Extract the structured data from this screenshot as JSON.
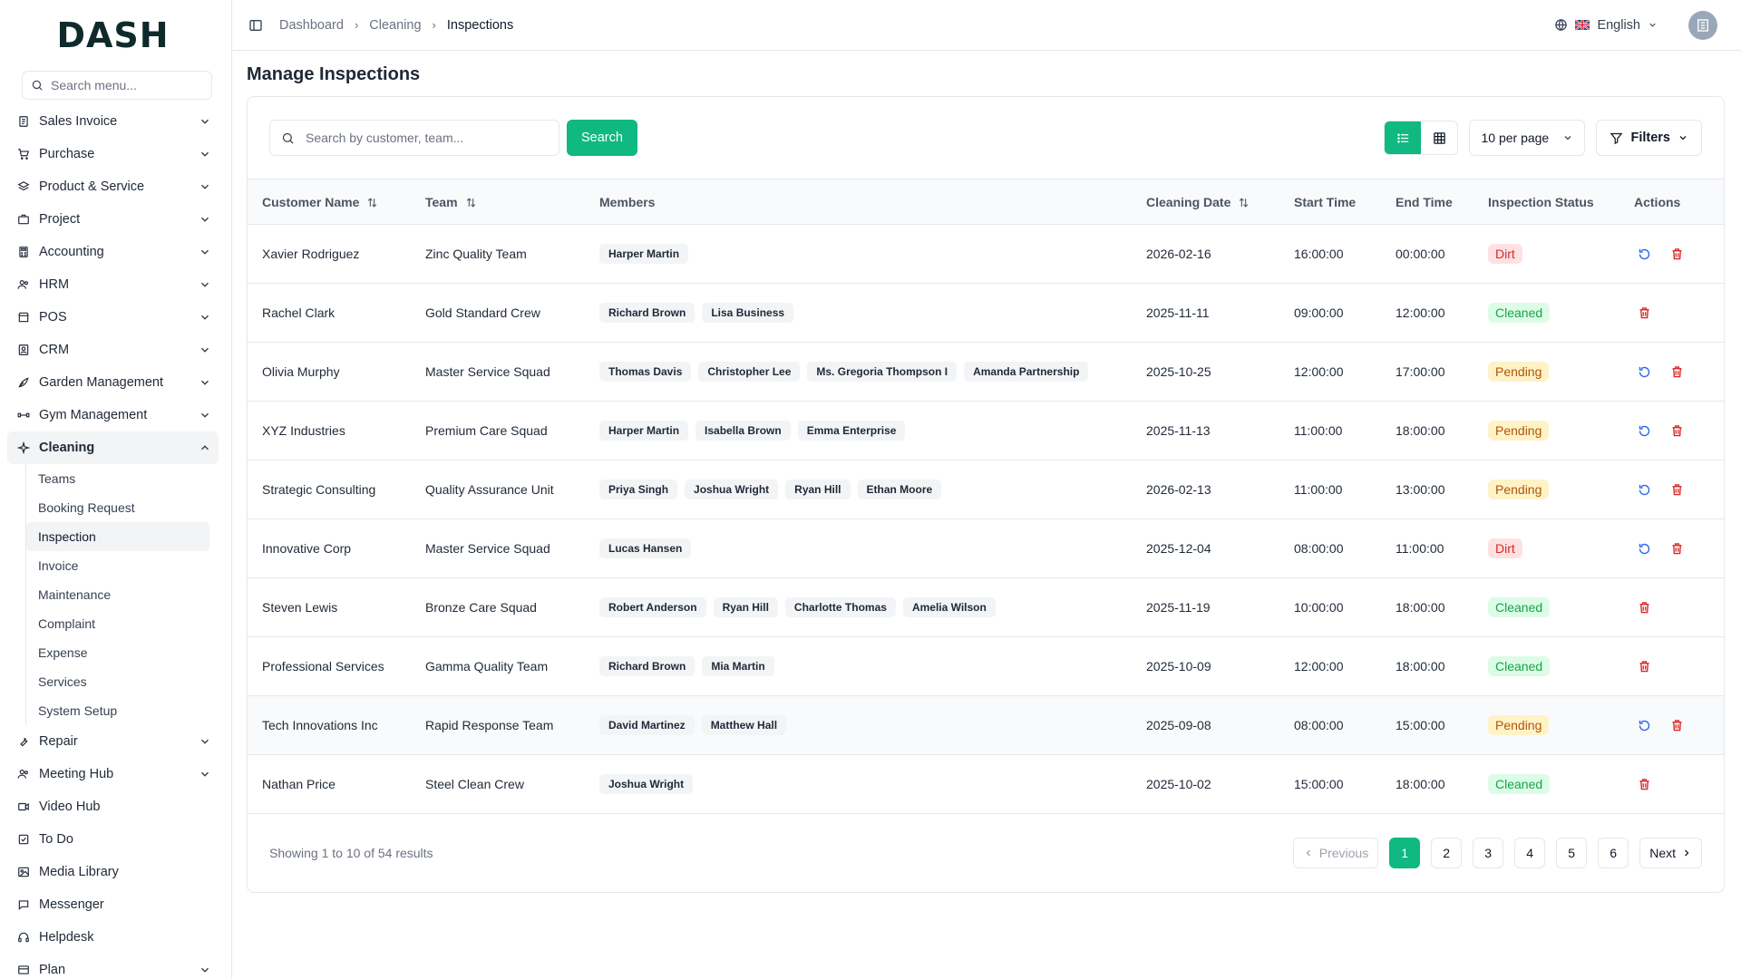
{
  "brand": {
    "logo": "DASH"
  },
  "sidebar": {
    "search_placeholder": "Search menu...",
    "items": [
      {
        "label": "Sales Invoice",
        "icon": "invoice-icon",
        "chevron": true
      },
      {
        "label": "Purchase",
        "icon": "cart-icon",
        "chevron": true
      },
      {
        "label": "Product & Service",
        "icon": "layers-icon",
        "chevron": true
      },
      {
        "label": "Project",
        "icon": "briefcase-icon",
        "chevron": true
      },
      {
        "label": "Accounting",
        "icon": "calculator-icon",
        "chevron": true
      },
      {
        "label": "HRM",
        "icon": "users-icon",
        "chevron": true
      },
      {
        "label": "POS",
        "icon": "store-icon",
        "chevron": true
      },
      {
        "label": "CRM",
        "icon": "contact-icon",
        "chevron": true
      },
      {
        "label": "Garden Management",
        "icon": "leaf-icon",
        "chevron": true
      },
      {
        "label": "Gym Management",
        "icon": "dumbbell-icon",
        "chevron": true
      },
      {
        "label": "Cleaning",
        "icon": "sparkle-icon",
        "chevron": true,
        "active": true
      }
    ],
    "cleaning_sub": [
      "Teams",
      "Booking Request",
      "Inspection",
      "Invoice",
      "Maintenance",
      "Complaint",
      "Expense",
      "Services",
      "System Setup"
    ],
    "items_after": [
      {
        "label": "Repair",
        "icon": "wrench-icon",
        "chevron": true
      },
      {
        "label": "Meeting Hub",
        "icon": "users-icon",
        "chevron": true
      },
      {
        "label": "Video Hub",
        "icon": "video-icon",
        "chevron": false
      },
      {
        "label": "To Do",
        "icon": "checkbox-icon",
        "chevron": false
      },
      {
        "label": "Media Library",
        "icon": "image-icon",
        "chevron": false
      },
      {
        "label": "Messenger",
        "icon": "message-icon",
        "chevron": false
      },
      {
        "label": "Helpdesk",
        "icon": "headset-icon",
        "chevron": false
      },
      {
        "label": "Plan",
        "icon": "card-icon",
        "chevron": true
      }
    ]
  },
  "topbar": {
    "breadcrumb": [
      "Dashboard",
      "Cleaning",
      "Inspections"
    ],
    "language": "English"
  },
  "page": {
    "title": "Manage Inspections"
  },
  "toolbar": {
    "search_placeholder": "Search by customer, team...",
    "search_button": "Search",
    "per_page": "10 per page",
    "filters": "Filters"
  },
  "table": {
    "headers": [
      "Customer Name",
      "Team",
      "Members",
      "Cleaning Date",
      "Start Time",
      "End Time",
      "Inspection Status",
      "Actions"
    ],
    "rows": [
      {
        "customer": "Xavier Rodriguez",
        "team": "Zinc Quality Team",
        "members": [
          "Harper Martin"
        ],
        "date": "2026-02-16",
        "start": "16:00:00",
        "end": "00:00:00",
        "status": "Dirt",
        "reset": true
      },
      {
        "customer": "Rachel Clark",
        "team": "Gold Standard Crew",
        "members": [
          "Richard Brown",
          "Lisa Business"
        ],
        "date": "2025-11-11",
        "start": "09:00:00",
        "end": "12:00:00",
        "status": "Cleaned",
        "reset": false
      },
      {
        "customer": "Olivia Murphy",
        "team": "Master Service Squad",
        "members": [
          "Thomas Davis",
          "Christopher Lee",
          "Ms. Gregoria Thompson I",
          "Amanda Partnership"
        ],
        "date": "2025-10-25",
        "start": "12:00:00",
        "end": "17:00:00",
        "status": "Pending",
        "reset": true
      },
      {
        "customer": "XYZ Industries",
        "team": "Premium Care Squad",
        "members": [
          "Harper Martin",
          "Isabella Brown",
          "Emma Enterprise"
        ],
        "date": "2025-11-13",
        "start": "11:00:00",
        "end": "18:00:00",
        "status": "Pending",
        "reset": true
      },
      {
        "customer": "Strategic Consulting",
        "team": "Quality Assurance Unit",
        "members": [
          "Priya Singh",
          "Joshua Wright",
          "Ryan Hill",
          "Ethan Moore"
        ],
        "date": "2026-02-13",
        "start": "11:00:00",
        "end": "13:00:00",
        "status": "Pending",
        "reset": true
      },
      {
        "customer": "Innovative Corp",
        "team": "Master Service Squad",
        "members": [
          "Lucas Hansen"
        ],
        "date": "2025-12-04",
        "start": "08:00:00",
        "end": "11:00:00",
        "status": "Dirt",
        "reset": true
      },
      {
        "customer": "Steven Lewis",
        "team": "Bronze Care Squad",
        "members": [
          "Robert Anderson",
          "Ryan Hill",
          "Charlotte Thomas",
          "Amelia Wilson"
        ],
        "date": "2025-11-19",
        "start": "10:00:00",
        "end": "18:00:00",
        "status": "Cleaned",
        "reset": false
      },
      {
        "customer": "Professional Services",
        "team": "Gamma Quality Team",
        "members": [
          "Richard Brown",
          "Mia Martin"
        ],
        "date": "2025-10-09",
        "start": "12:00:00",
        "end": "18:00:00",
        "status": "Cleaned",
        "reset": false
      },
      {
        "customer": "Tech Innovations Inc",
        "team": "Rapid Response Team",
        "members": [
          "David Martinez",
          "Matthew Hall"
        ],
        "date": "2025-09-08",
        "start": "08:00:00",
        "end": "15:00:00",
        "status": "Pending",
        "reset": true
      },
      {
        "customer": "Nathan Price",
        "team": "Steel Clean Crew",
        "members": [
          "Joshua Wright"
        ],
        "date": "2025-10-02",
        "start": "15:00:00",
        "end": "18:00:00",
        "status": "Cleaned",
        "reset": false
      }
    ]
  },
  "footer": {
    "showing": "Showing 1 to 10 of 54 results",
    "previous": "Previous",
    "next": "Next",
    "pages": [
      "1",
      "2",
      "3",
      "4",
      "5",
      "6"
    ],
    "current_page": "1"
  },
  "colors": {
    "accent": "#10b981",
    "danger": "#dc2626",
    "reset": "#2563eb"
  }
}
